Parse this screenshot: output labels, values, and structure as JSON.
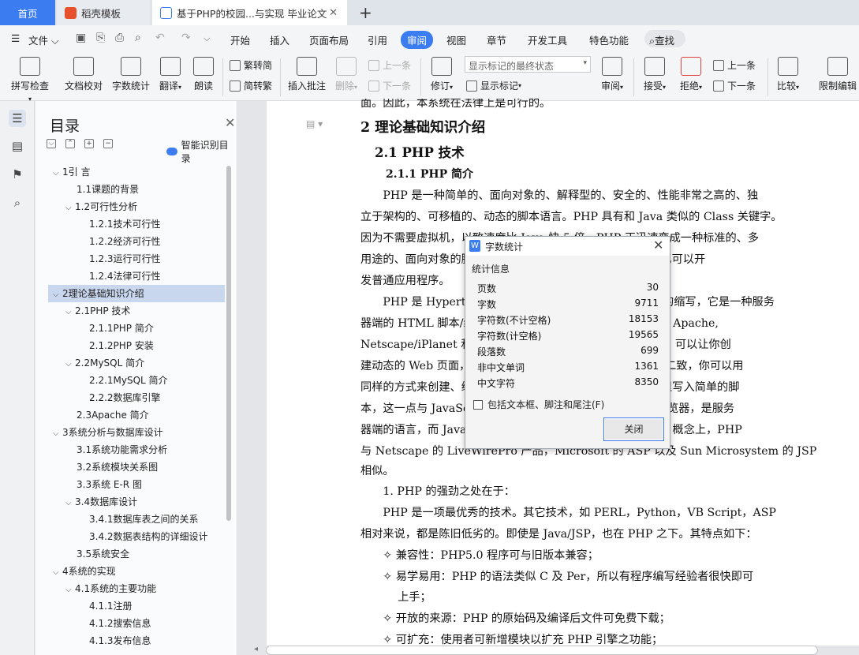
{
  "tabs": {
    "home": "首页",
    "template": "稻壳模板",
    "doc": "基于PHP的校园...与实现 毕业论文"
  },
  "menu": {
    "file": "文件",
    "items": [
      "开始",
      "插入",
      "页面布局",
      "引用",
      "审阅",
      "视图",
      "章节",
      "开发工具",
      "特色功能"
    ],
    "search": "查找"
  },
  "ribbon": {
    "spell": "拼写检查",
    "proof": "文档校对",
    "wordcount": "字数统计",
    "translate": "翻译",
    "read": "朗读",
    "trad": "繁转简",
    "simp": "简转繁",
    "insert_comment": "插入批注",
    "delete": "删除",
    "prev_comment": "上一条",
    "next_comment": "下一条",
    "revise": "修订",
    "markup_dropdown": "显示标记的最终状态",
    "show_markup": "显示标记",
    "review": "审阅",
    "accept": "接受",
    "reject": "拒绝",
    "prev": "上一条",
    "next": "下一条",
    "compare": "比较",
    "restrict": "限制编辑"
  },
  "toc": {
    "title": "目录",
    "smart": "智能识别目录",
    "items": [
      "1引 言",
      "1.1课题的背景",
      "1.2可行性分析",
      "1.2.1技术可行性",
      "1.2.2经济可行性",
      "1.2.3运行可行性",
      "1.2.4法律可行性",
      "2理论基础知识介绍",
      "2.1PHP 技术",
      "2.1.1PHP 简介",
      "2.1.2PHP 安装",
      "2.2MySQL 简介",
      "2.2.1MySQL 简介",
      "2.2.2数据库引擎",
      "2.3Apache 简介",
      "3系统分析与数据库设计",
      "3.1系统功能需求分析",
      "3.2系统模块关系图",
      "3.3系统 E-R 图",
      "3.4数据库设计",
      "3.4.1数据库表之间的关系",
      "3.4.2数据表结构的详细设计",
      "3.5系统安全",
      "4系统的实现",
      "4.1系统的主要功能",
      "4.1.1注册",
      "4.1.2搜索信息",
      "4.1.3发布信息"
    ]
  },
  "doc": {
    "top_line": "面。因此，本系统在法律上是可行的。",
    "h1": "2  理论基础知识介绍",
    "h2": "2.1 PHP 技术",
    "h3": "2.1.1  PHP 简介",
    "lines": [
      "　　PHP 是一种简单的、面向对象的、解释型的、安全的、性能非常之高的、独",
      "立于架构的、可移植的、动态的脚本语言。PHP 具有和 Java 类似的 Class 关键字。",
      "因为不需要虚拟机，以致速度比 Java 快 5 倍。PHP 正迅速变成一种标准的、多",
      "用途的、面向对象的脚本语言，可用于开发 Web 应用程序，也可以开",
      "发普通应用程序。",
      "　　PHP 是 Hypertext Preprocessor（超文本预处理器）的缩写，它是一种服务",
      "器端的 HTML 脚本/编程语言，语法与 C 语言类似，可运行在 Apache,",
      "Netscape/iPlanet 和 IIS Web 服务器上。PHP 是一种工具，可以让你创",
      "建动态的 Web 页面，PHP 的网页与普通的 HTML 页面并无二致，你可以用",
      "同样的方式来创建、编辑它们，你可以在普通的 HTML 文件里写入简单的脚",
      "本，这一点与 JavaScript 相似，不同的是，PHP 不依赖于浏览器，是服务",
      "器端的语言，而 JavaScript 是一种在客户端浏览器中的语言。概念上，PHP",
      "与 Netscape 的 LiveWirePro 产品，Microsoft 的 ASP 以及 Sun Microsystem 的 JSP",
      "相似。",
      "　　1. PHP 的强劲之处在于：",
      "　　PHP 是一项最优秀的技术。其它技术，如 PERL，Python，VB Script，ASP",
      "相对来说，都是陈旧低劣的。即使是 Java/JSP，也在 PHP 之下。其特点如下：",
      "　　✧  兼容性：PHP5.0 程序可与旧版本兼容；",
      "　　✧  易学易用：PHP 的语法类似 C 及 Per，所以有程序编写经验者很快即可",
      "　　　 上手；",
      "　　✧  开放的来源：PHP 的原始码及编译后文件可免费下载；",
      "　　✧  可扩充：使用者可新增模块以扩充 PHP 引擎之功能；"
    ]
  },
  "dialog": {
    "title": "字数统计",
    "section": "统计信息",
    "rows": [
      {
        "label": "页数",
        "value": "30"
      },
      {
        "label": "字数",
        "value": "9711"
      },
      {
        "label": "字符数(不计空格)",
        "value": "18153"
      },
      {
        "label": "字符数(计空格)",
        "value": "19565"
      },
      {
        "label": "段落数",
        "value": "699"
      },
      {
        "label": "非中文单词",
        "value": "1361"
      },
      {
        "label": "中文字符",
        "value": "8350"
      }
    ],
    "checkbox": "包括文本框、脚注和尾注(F)",
    "close": "关闭"
  }
}
